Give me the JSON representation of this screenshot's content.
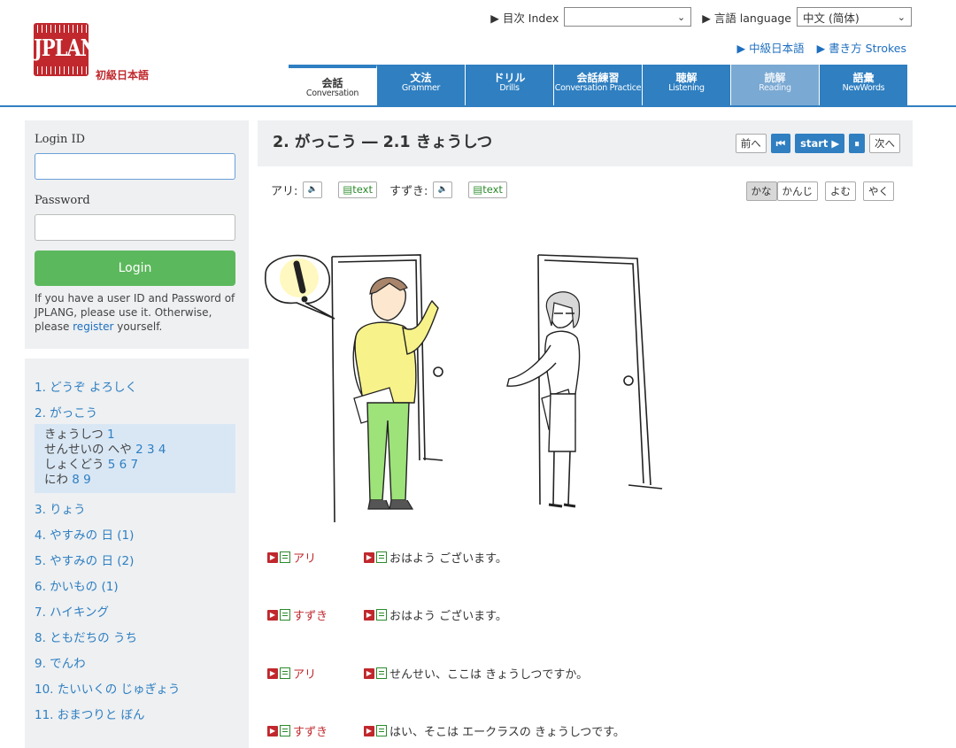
{
  "header": {
    "logo_text": "JPLANG",
    "site_subtitle": "初級日本語",
    "index_label": "▶ 目次 Index",
    "index_value": "",
    "language_label": "▶ 言語 language",
    "language_value": "中文 (简体)",
    "links": [
      "▶ 中級日本語",
      "▶ 書き方 Strokes"
    ]
  },
  "nav": {
    "tabs": [
      {
        "jp": "会話",
        "en": "Conversation",
        "state": "active"
      },
      {
        "jp": "文法",
        "en": "Grammer",
        "state": "normal"
      },
      {
        "jp": "ドリル",
        "en": "Drills",
        "state": "normal"
      },
      {
        "jp": "会話練習",
        "en": "Conversation Practice",
        "state": "normal"
      },
      {
        "jp": "聴解",
        "en": "Listening",
        "state": "normal"
      },
      {
        "jp": "読解",
        "en": "Reading",
        "state": "dim"
      },
      {
        "jp": "語彙",
        "en": "NewWords",
        "state": "normal"
      }
    ]
  },
  "login": {
    "id_label": "Login ID",
    "id_value": "",
    "password_label": "Password",
    "password_value": "",
    "button": "Login",
    "note_before": "If you have a user ID and Password of JPLANG, please use it. Otherwise, please ",
    "note_link": "register",
    "note_after": " yourself."
  },
  "lessons": {
    "items": [
      "1. どうぞ よろしく",
      "2. がっこう",
      "3. りょう",
      "4. やすみの 日 (1)",
      "5. やすみの 日 (2)",
      "6. かいもの (1)",
      "7. ハイキング",
      "8. ともだちの うち",
      "9. でんわ",
      "10. たいいくの じゅぎょう",
      "11. おまつりと ぼん"
    ],
    "sub": [
      {
        "text": "きょうしつ",
        "nums": "1"
      },
      {
        "text": "せんせいの へや",
        "nums": "2 3 4"
      },
      {
        "text": "しょくどう",
        "nums": "5 6 7"
      },
      {
        "text": "にわ",
        "nums": "8 9"
      }
    ]
  },
  "main": {
    "title": "2. がっこう ― 2.1 きょうしつ",
    "controls": {
      "prev": "前へ",
      "rewind": "⏮",
      "start": "start ▶",
      "pause": "⏸",
      "next": "次へ"
    },
    "speaker1": "アリ:",
    "speaker2": "すずき:",
    "speaker_icon": "🔈",
    "text_label": "text",
    "script_toggle": [
      "かな",
      "かんじ"
    ],
    "yomu": "よむ",
    "yaku": "やく",
    "dialog": [
      {
        "speaker": "アリ",
        "line": "おはよう ございます。"
      },
      {
        "speaker": "すずき",
        "line": "おはよう ございます。"
      },
      {
        "speaker": "アリ",
        "line": "せんせい、ここは きょうしつですか。"
      },
      {
        "speaker": "すずき",
        "line": "はい、そこは エークラスの きょうしつです。"
      }
    ]
  },
  "colors": {
    "accent_blue": "#2f7fc1",
    "brand_red": "#c0282d",
    "login_green": "#5cb85c"
  }
}
